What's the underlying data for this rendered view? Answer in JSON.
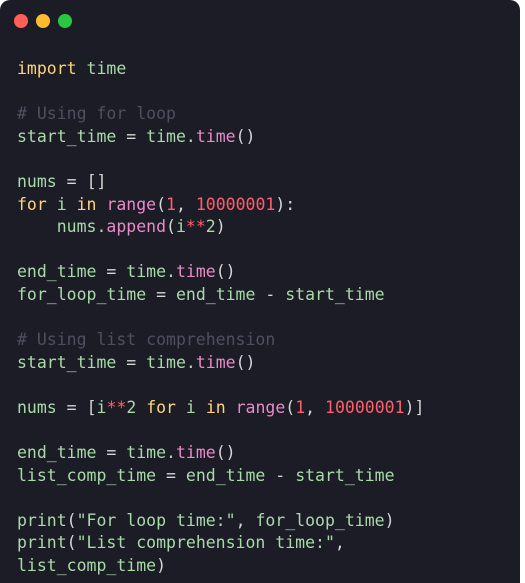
{
  "window": {
    "controls": [
      {
        "name": "close",
        "color": "#ff5f57"
      },
      {
        "name": "minimize",
        "color": "#febc2e"
      },
      {
        "name": "maximize",
        "color": "#28c840"
      }
    ]
  },
  "colors": {
    "default": "#a8dba8",
    "keyword": "#ffd479",
    "function": "#e88bc8",
    "number": "#ff5f6d",
    "comment": "#4d5060",
    "operator": "#d6d6d6"
  },
  "code": {
    "lines": [
      [
        {
          "t": "import",
          "c": "keyword"
        },
        {
          "t": " time",
          "c": "default"
        }
      ],
      [],
      [
        {
          "t": "# Using for loop",
          "c": "comment"
        }
      ],
      [
        {
          "t": "start_time",
          "c": "default"
        },
        {
          "t": " = ",
          "c": "operator"
        },
        {
          "t": "time.",
          "c": "default"
        },
        {
          "t": "time",
          "c": "function"
        },
        {
          "t": "()",
          "c": "operator"
        }
      ],
      [],
      [
        {
          "t": "nums",
          "c": "default"
        },
        {
          "t": " = ",
          "c": "operator"
        },
        {
          "t": "[]",
          "c": "operator"
        }
      ],
      [
        {
          "t": "for",
          "c": "keyword"
        },
        {
          "t": " i ",
          "c": "default"
        },
        {
          "t": "in",
          "c": "keyword"
        },
        {
          "t": " ",
          "c": "default"
        },
        {
          "t": "range",
          "c": "function"
        },
        {
          "t": "(",
          "c": "operator"
        },
        {
          "t": "1",
          "c": "number"
        },
        {
          "t": ", ",
          "c": "operator"
        },
        {
          "t": "10000001",
          "c": "number"
        },
        {
          "t": "):",
          "c": "operator"
        }
      ],
      [
        {
          "t": "    nums.",
          "c": "default"
        },
        {
          "t": "append",
          "c": "function"
        },
        {
          "t": "(",
          "c": "operator"
        },
        {
          "t": "i",
          "c": "default"
        },
        {
          "t": "**",
          "c": "number"
        },
        {
          "t": "2",
          "c": "default"
        },
        {
          "t": ")",
          "c": "operator"
        }
      ],
      [],
      [
        {
          "t": "end_time",
          "c": "default"
        },
        {
          "t": " = ",
          "c": "operator"
        },
        {
          "t": "time.",
          "c": "default"
        },
        {
          "t": "time",
          "c": "function"
        },
        {
          "t": "()",
          "c": "operator"
        }
      ],
      [
        {
          "t": "for_loop_time",
          "c": "default"
        },
        {
          "t": " = ",
          "c": "operator"
        },
        {
          "t": "end_time",
          "c": "default"
        },
        {
          "t": " - ",
          "c": "operator"
        },
        {
          "t": "start_time",
          "c": "default"
        }
      ],
      [],
      [
        {
          "t": "# Using list comprehension",
          "c": "comment"
        }
      ],
      [
        {
          "t": "start_time",
          "c": "default"
        },
        {
          "t": " = ",
          "c": "operator"
        },
        {
          "t": "time.",
          "c": "default"
        },
        {
          "t": "time",
          "c": "function"
        },
        {
          "t": "()",
          "c": "operator"
        }
      ],
      [],
      [
        {
          "t": "nums",
          "c": "default"
        },
        {
          "t": " = ",
          "c": "operator"
        },
        {
          "t": "[",
          "c": "operator"
        },
        {
          "t": "i",
          "c": "default"
        },
        {
          "t": "**",
          "c": "number"
        },
        {
          "t": "2 ",
          "c": "default"
        },
        {
          "t": "for",
          "c": "keyword"
        },
        {
          "t": " i ",
          "c": "default"
        },
        {
          "t": "in",
          "c": "keyword"
        },
        {
          "t": " ",
          "c": "default"
        },
        {
          "t": "range",
          "c": "function"
        },
        {
          "t": "(",
          "c": "operator"
        },
        {
          "t": "1",
          "c": "number"
        },
        {
          "t": ", ",
          "c": "operator"
        },
        {
          "t": "10000001",
          "c": "number"
        },
        {
          "t": ")]",
          "c": "operator"
        }
      ],
      [],
      [
        {
          "t": "end_time",
          "c": "default"
        },
        {
          "t": " = ",
          "c": "operator"
        },
        {
          "t": "time.",
          "c": "default"
        },
        {
          "t": "time",
          "c": "function"
        },
        {
          "t": "()",
          "c": "operator"
        }
      ],
      [
        {
          "t": "list_comp_time",
          "c": "default"
        },
        {
          "t": " = ",
          "c": "operator"
        },
        {
          "t": "end_time",
          "c": "default"
        },
        {
          "t": " - ",
          "c": "operator"
        },
        {
          "t": "start_time",
          "c": "default"
        }
      ],
      [],
      [
        {
          "t": "print",
          "c": "default"
        },
        {
          "t": "(",
          "c": "operator"
        },
        {
          "t": "\"For loop time:\"",
          "c": "default"
        },
        {
          "t": ", ",
          "c": "operator"
        },
        {
          "t": "for_loop_time",
          "c": "default"
        },
        {
          "t": ")",
          "c": "operator"
        }
      ],
      [
        {
          "t": "print",
          "c": "default"
        },
        {
          "t": "(",
          "c": "operator"
        },
        {
          "t": "\"List comprehension time:\"",
          "c": "default"
        },
        {
          "t": ",",
          "c": "operator"
        }
      ],
      [
        {
          "t": "list_comp_time",
          "c": "default"
        },
        {
          "t": ")",
          "c": "operator"
        }
      ]
    ]
  }
}
